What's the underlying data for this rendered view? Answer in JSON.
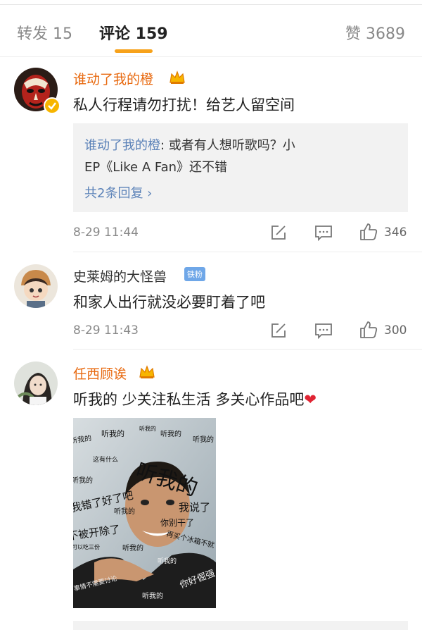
{
  "tabs": {
    "repost": "转发 15",
    "comments": "评论 159",
    "likes": "赞 3689"
  },
  "comments": [
    {
      "username": "谁动了我的橙",
      "content": "私人行程请勿打扰！给艺人留空间",
      "reply": {
        "author": "谁动了我的橙",
        "text_line1": ": 或者有人想听歌吗？小",
        "text_line2": "EP《Like A Fan》还不错",
        "more": "共2条回复 ›"
      },
      "time": "8-29 11:44",
      "likes": "346"
    },
    {
      "username": "史莱姆的大怪兽",
      "badge": "铁粉",
      "content": "和家人出行就没必要盯着了吧",
      "time": "8-29 11:43",
      "likes": "300"
    },
    {
      "username": "任西顾诶",
      "content": "听我的 少关注私生活 多关心作品吧",
      "heart": "❤"
    }
  ],
  "meme": {
    "words": [
      "听我的",
      "听我的",
      "听我的",
      "听我的",
      "听我的",
      "这有什么",
      "听我的",
      "听我的",
      "我错了好了吧",
      "听我的",
      "我说了",
      "你别干了",
      "不被开除了",
      "听我的",
      "再买个冰箱不就",
      "可以吃三份",
      "事情不需要讨论",
      "听我的",
      "你好倔强",
      "听我的"
    ]
  }
}
